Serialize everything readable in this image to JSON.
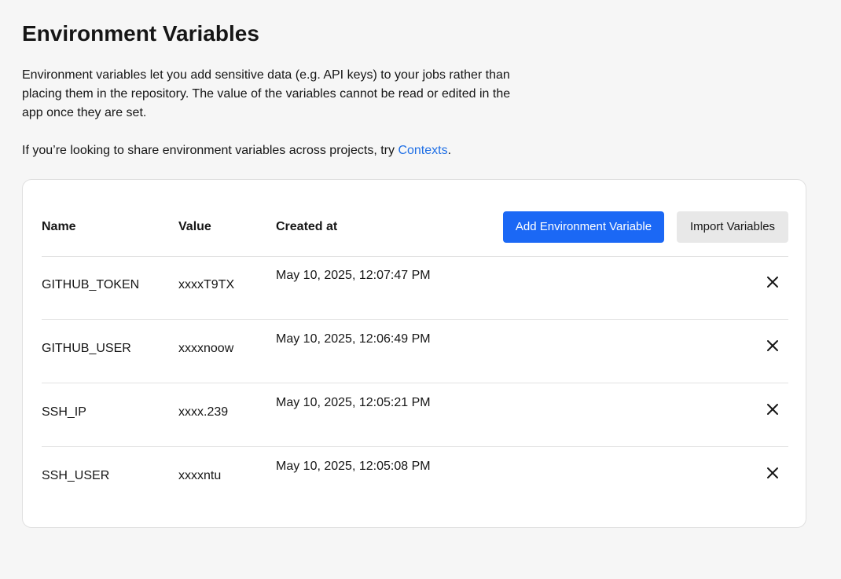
{
  "page": {
    "title": "Environment Variables",
    "description": "Environment variables let you add sensitive data (e.g. API keys) to your jobs rather than placing them in the repository. The value of the variables cannot be read or edited in the app once they are set.",
    "share_prefix": "If you’re looking to share environment variables across projects, try ",
    "share_link": "Contexts",
    "share_suffix": "."
  },
  "table": {
    "headers": {
      "name": "Name",
      "value": "Value",
      "created": "Created at"
    },
    "actions": {
      "add_label": "Add Environment Variable",
      "import_label": "Import Variables"
    },
    "rows": [
      {
        "name": "GITHUB_TOKEN",
        "value": "xxxxT9TX",
        "created": "May 10, 2025, 12:07:47 PM"
      },
      {
        "name": "GITHUB_USER",
        "value": "xxxxnoow",
        "created": "May 10, 2025, 12:06:49 PM"
      },
      {
        "name": "SSH_IP",
        "value": "xxxx.239",
        "created": "May 10, 2025, 12:05:21 PM"
      },
      {
        "name": "SSH_USER",
        "value": "xxxxntu",
        "created": "May 10, 2025, 12:05:08 PM"
      }
    ],
    "delete_icon": "close-icon"
  },
  "colors": {
    "background": "#f6f6f6",
    "primary_button": "#1b68f5",
    "secondary_button": "#e8e8e8",
    "link": "#1f6fe5"
  }
}
